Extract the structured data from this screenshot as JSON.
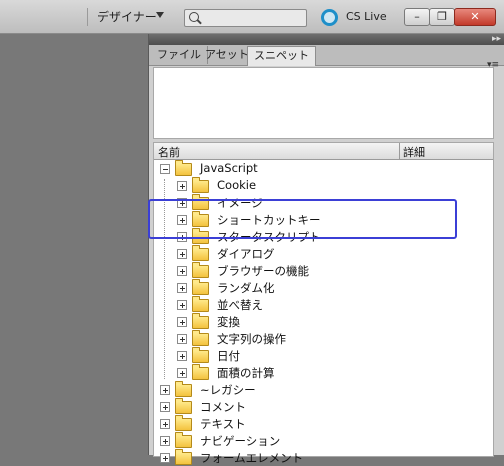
{
  "toolbar": {
    "workspace_label": "デザイナー",
    "search_placeholder": "",
    "cs_live_label": "CS Live",
    "minimize_glyph": "–",
    "restore_glyph": "❐",
    "close_glyph": "✕"
  },
  "panel": {
    "collapse_glyph": "▸▸",
    "menu_glyph": "▾≡",
    "tabs": [
      {
        "label": "ファイル",
        "active": false
      },
      {
        "label": "アセット",
        "active": false
      },
      {
        "label": "スニペット",
        "active": true
      }
    ],
    "columns": {
      "name": "名前",
      "detail": "詳細"
    }
  },
  "tree": {
    "root": {
      "label": "JavaScript",
      "expanded": true
    },
    "children": [
      {
        "label": "Cookie"
      },
      {
        "label": "イメージ"
      },
      {
        "label": "ショートカットキー"
      },
      {
        "label": "スタータスクリプト"
      },
      {
        "label": "ダイアログ"
      },
      {
        "label": "ブラウザーの機能"
      },
      {
        "label": "ランダム化"
      },
      {
        "label": "並べ替え"
      },
      {
        "label": "変換"
      },
      {
        "label": "文字列の操作"
      },
      {
        "label": "日付"
      },
      {
        "label": "面積の計算"
      }
    ],
    "siblings": [
      {
        "label": "~レガシー"
      },
      {
        "label": "コメント"
      },
      {
        "label": "テキスト"
      },
      {
        "label": "ナビゲーション"
      },
      {
        "label": "フォームエレメント"
      }
    ]
  },
  "colors": {
    "accent": "#1e8fc9",
    "highlight": "#3b3fd6",
    "folder": "#f3c23e"
  }
}
